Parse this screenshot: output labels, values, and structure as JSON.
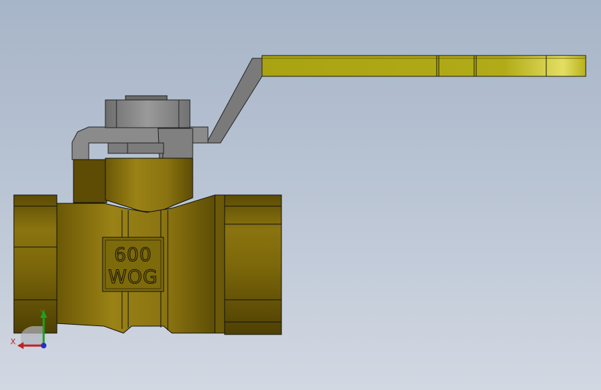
{
  "viewport": {
    "background_top": "#a7b5c8",
    "background_bottom": "#d2d8e2"
  },
  "model": {
    "name": "ball-valve",
    "body_color": "#7a6608",
    "handle_color": "#b9b21a",
    "stem_color": "#8e8e8e",
    "marking_line1": "600",
    "marking_line2": "WOG"
  },
  "triad": {
    "x_label": "X",
    "y_label": "Y",
    "x_color": "#c42020",
    "y_color": "#1fa01f",
    "z_color": "#2030c8"
  }
}
